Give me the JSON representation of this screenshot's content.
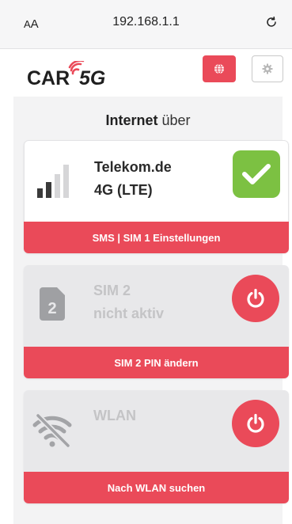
{
  "browser": {
    "text_size_label_small": "A",
    "text_size_label_large": "A",
    "url": "192.168.1.1",
    "reload_icon": "reload-icon"
  },
  "header": {
    "logo_text_left": "CAR",
    "logo_text_right": "5G",
    "language_icon": "globe-icon",
    "settings_icon": "gear-icon"
  },
  "section": {
    "title_bold": "Internet",
    "title_rest": " über"
  },
  "cards": [
    {
      "line1": "Telekom.de",
      "line2": "4G (LTE)",
      "icon": "signal-bars-icon",
      "status_icon": "check-icon",
      "footer": "SMS | SIM 1 Einstellungen"
    },
    {
      "line1": "SIM 2",
      "line2": "nicht aktiv",
      "icon": "sim-card-icon",
      "icon_label": "2",
      "status_icon": "power-icon",
      "footer": "SIM 2 PIN ändern"
    },
    {
      "line1": "WLAN",
      "line2": "",
      "icon": "wifi-off-icon",
      "status_icon": "power-icon",
      "footer": "Nach WLAN suchen"
    }
  ],
  "colors": {
    "accent": "#ea4a59",
    "success": "#7cc142",
    "panel": "#f3f3f4",
    "inactive_card": "#e8e8ea",
    "inactive_text": "#c4c4c6"
  }
}
